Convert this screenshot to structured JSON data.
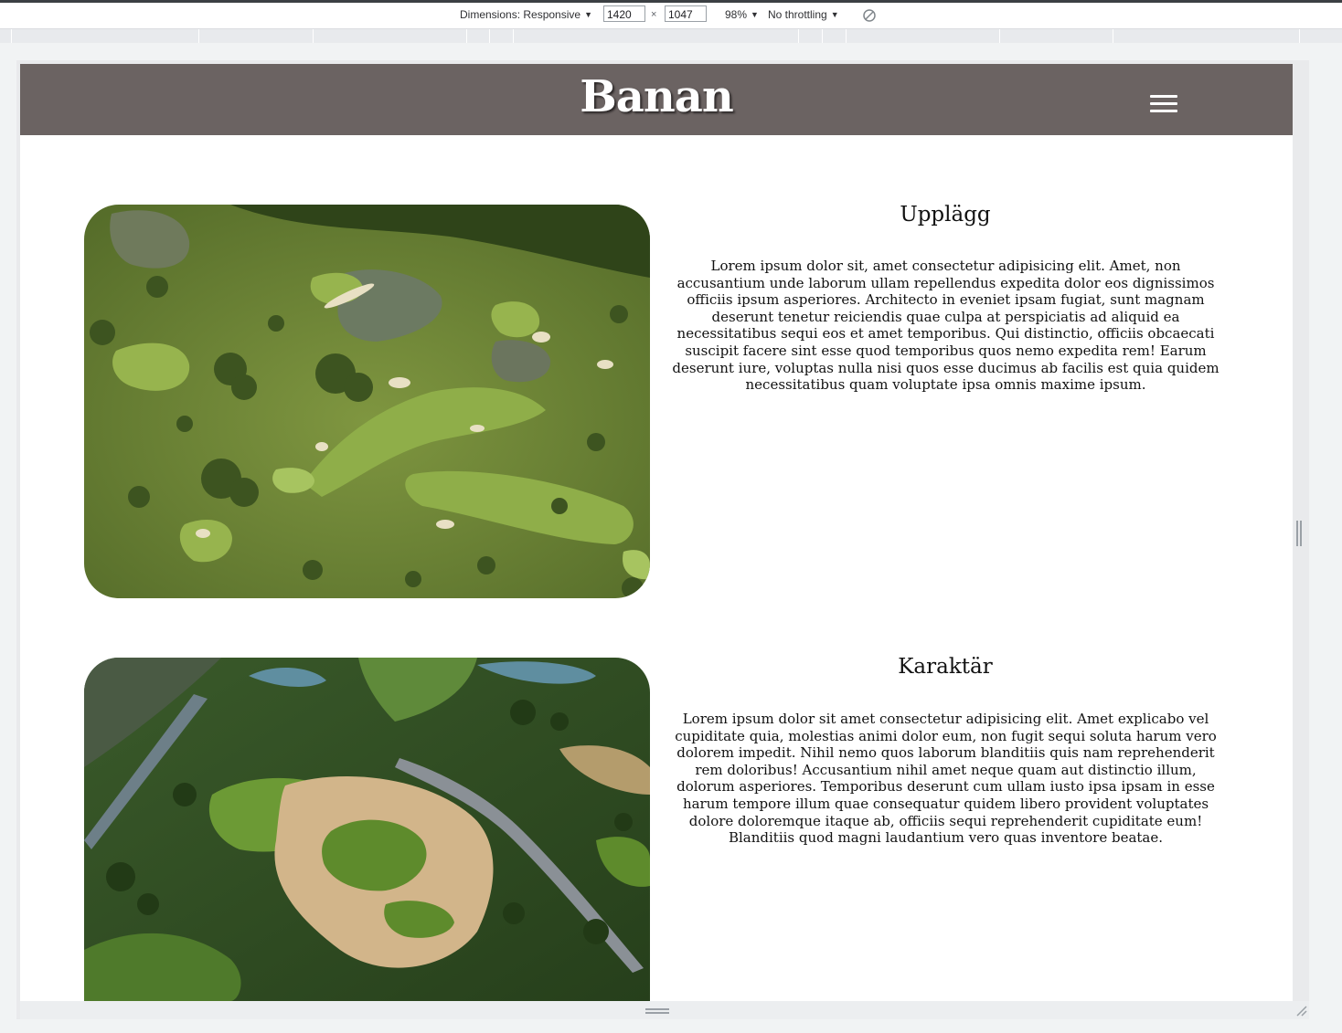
{
  "devtools": {
    "dimensions_label": "Dimensions: Responsive",
    "width_value": "1420",
    "height_value": "1047",
    "times": "×",
    "zoom": "98%",
    "throttling": "No throttling"
  },
  "site": {
    "title": "Banan"
  },
  "sections": [
    {
      "title": "Upplägg",
      "text": "Lorem ipsum dolor sit, amet consectetur adipisicing elit. Amet, non accusantium unde laborum ullam repellendus expedita dolor eos dignissimos officiis ipsum asperiores. Architecto in eveniet ipsam fugiat, sunt magnam deserunt tenetur reiciendis quae culpa at perspiciatis ad aliquid ea necessitatibus sequi eos et amet temporibus. Qui distinctio, officiis obcaecati suscipit facere sint esse quod temporibus quos nemo expedita rem! Earum deserunt iure, voluptas nulla nisi quos esse ducimus ab facilis est quia quidem necessitatibus quam voluptate ipsa omnis maxime ipsum."
    },
    {
      "title": "Karaktär",
      "text": "Lorem ipsum dolor sit amet consectetur adipisicing elit. Amet explicabo vel cupiditate quia, molestias animi dolor eum, non fugit sequi soluta harum vero dolorem impedit. Nihil nemo quos laborum blanditiis quis nam reprehenderit rem doloribus! Accusantium nihil amet neque quam aut distinctio illum, dolorum asperiores. Temporibus deserunt cum ullam iusto ipsa ipsam in esse harum tempore illum quae consequatur quidem libero provident voluptates dolore doloremque itaque ab, officiis sequi reprehenderit cupiditate eum! Blanditiis quod magni laudantium vero quas inventore beatae."
    }
  ],
  "icons": {
    "menu": "hamburger-menu-icon",
    "rotate": "rotate-disabled-icon"
  },
  "colors": {
    "header_bg": "#6b6362",
    "header_text": "#ffffff"
  }
}
